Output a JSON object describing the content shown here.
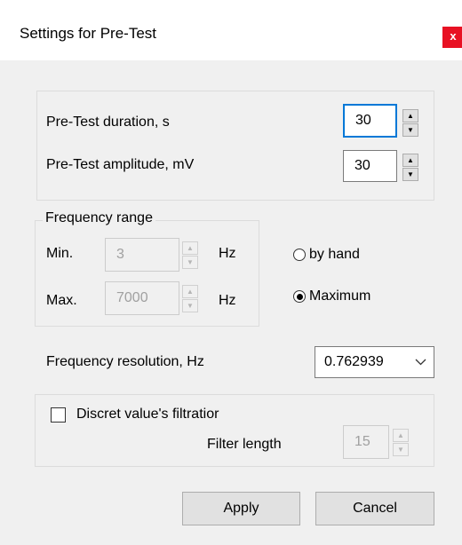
{
  "window": {
    "title": "Settings for Pre-Test",
    "close_label": "x"
  },
  "pretest": {
    "duration_label": "Pre-Test duration, s",
    "duration_value": "30",
    "amplitude_label": "Pre-Test amplitude, mV",
    "amplitude_value": "30"
  },
  "frequency_range": {
    "legend": "Frequency range",
    "min_label": "Min.",
    "min_value": "3",
    "min_unit": "Hz",
    "max_label": "Max.",
    "max_value": "7000",
    "max_unit": "Hz",
    "radio_by_hand": "by hand",
    "radio_maximum": "Maximum",
    "selected_mode": "Maximum"
  },
  "resolution": {
    "label": "Frequency resolution, Hz",
    "selected_value": "0.762939"
  },
  "filtration": {
    "checkbox_label": "Discret value's filtratior",
    "checked": false,
    "filter_length_label": "Filter length",
    "filter_length_value": "15"
  },
  "buttons": {
    "apply": "Apply",
    "cancel": "Cancel"
  },
  "colors": {
    "focus_accent": "#0078d7",
    "close_red": "#e81123",
    "dialog_bg": "#f0f0f0"
  }
}
